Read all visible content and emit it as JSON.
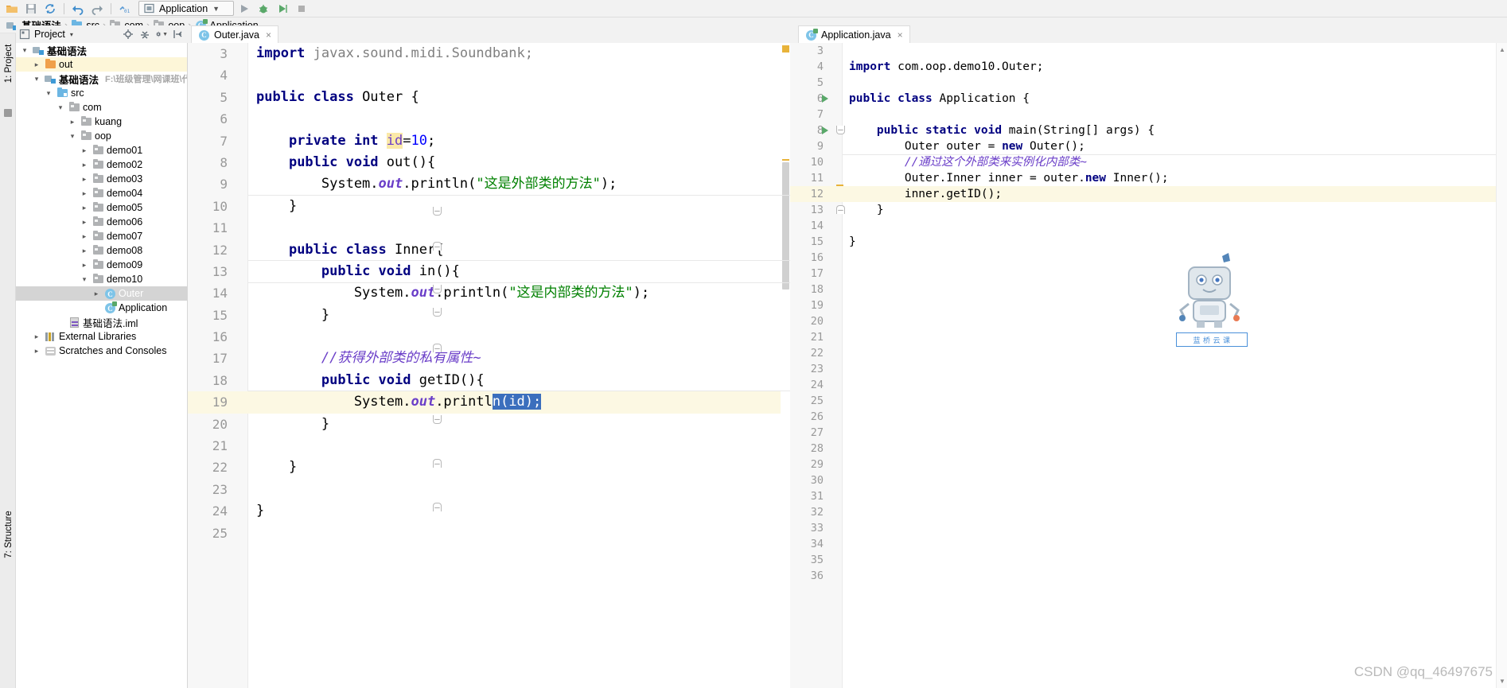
{
  "toolbar": {
    "icons": [
      "open-folder-icon",
      "save-icon",
      "sync-icon",
      "undo-icon",
      "redo-icon",
      "build-icon"
    ],
    "run_config_label": "Application",
    "run_icon": "run-icon",
    "debug_icon": "debug-icon",
    "coverage_icon": "coverage-icon",
    "stop_icon": "stop-icon"
  },
  "breadcrumb": {
    "items": [
      {
        "label": "基础语法",
        "icon": "module-icon"
      },
      {
        "label": "src",
        "icon": "source-folder-icon"
      },
      {
        "label": "com",
        "icon": "package-icon"
      },
      {
        "label": "oop",
        "icon": "package-icon"
      },
      {
        "label": "Application",
        "icon": "java-class-icon"
      }
    ],
    "separator": "›"
  },
  "left_rail": {
    "top_label": "1: Project",
    "bottom_label": "7: Structure"
  },
  "project_panel": {
    "title": "Project",
    "caret": "▾",
    "icons": [
      "locate-icon",
      "collapse-all-icon",
      "settings-icon",
      "hide-icon"
    ],
    "tree": [
      {
        "depth": 0,
        "arrow": "⌄",
        "icon": "module-icon",
        "label": "基础语法",
        "bold": true
      },
      {
        "depth": 1,
        "arrow": "›",
        "icon": "folder-orange",
        "label": "out",
        "highlight": true
      },
      {
        "depth": 1,
        "arrow": "⌄",
        "icon": "module-icon",
        "label": "基础语法",
        "bold": true,
        "path": "F:\\班级管理\\网课班\\代码\\Ja"
      },
      {
        "depth": 2,
        "arrow": "⌄",
        "icon": "folder-src",
        "label": "src"
      },
      {
        "depth": 3,
        "arrow": "⌄",
        "icon": "folder-pkg",
        "label": "com"
      },
      {
        "depth": 4,
        "arrow": "›",
        "icon": "folder-pkg",
        "label": "kuang"
      },
      {
        "depth": 4,
        "arrow": "⌄",
        "icon": "folder-pkg",
        "label": "oop"
      },
      {
        "depth": 5,
        "arrow": "›",
        "icon": "folder-pkg",
        "label": "demo01"
      },
      {
        "depth": 5,
        "arrow": "›",
        "icon": "folder-pkg",
        "label": "demo02"
      },
      {
        "depth": 5,
        "arrow": "›",
        "icon": "folder-pkg",
        "label": "demo03"
      },
      {
        "depth": 5,
        "arrow": "›",
        "icon": "folder-pkg",
        "label": "demo04"
      },
      {
        "depth": 5,
        "arrow": "›",
        "icon": "folder-pkg",
        "label": "demo05"
      },
      {
        "depth": 5,
        "arrow": "›",
        "icon": "folder-pkg",
        "label": "demo06"
      },
      {
        "depth": 5,
        "arrow": "›",
        "icon": "folder-pkg",
        "label": "demo07"
      },
      {
        "depth": 5,
        "arrow": "›",
        "icon": "folder-pkg",
        "label": "demo08"
      },
      {
        "depth": 5,
        "arrow": "›",
        "icon": "folder-pkg",
        "label": "demo09"
      },
      {
        "depth": 5,
        "arrow": "⌄",
        "icon": "folder-pkg",
        "label": "demo10"
      },
      {
        "depth": 6,
        "arrow": "›",
        "icon": "java-class-icon",
        "label": "Outer",
        "selected": true
      },
      {
        "depth": 6,
        "arrow": "",
        "icon": "java-class-run-icon",
        "label": "Application"
      },
      {
        "depth": 3,
        "arrow": "",
        "icon": "iml-file-icon",
        "label": "基础语法.iml"
      },
      {
        "depth": 1,
        "arrow": "›",
        "icon": "libraries-icon",
        "label": "External Libraries"
      },
      {
        "depth": 1,
        "arrow": "›",
        "icon": "scratches-icon",
        "label": "Scratches and Consoles"
      }
    ]
  },
  "editor_left": {
    "tab": {
      "label": "Outer.java",
      "icon": "java-class-icon",
      "close": "×"
    },
    "first_line": 3,
    "lines": [
      {
        "no": 3,
        "tokens": [
          {
            "t": "import ",
            "c": "kw"
          },
          {
            "t": "javax.sound.midi.Soundbank;",
            "c": "cmt"
          }
        ]
      },
      {
        "no": 4,
        "tokens": []
      },
      {
        "no": 5,
        "tokens": [
          {
            "t": "public class ",
            "c": "kw"
          },
          {
            "t": "Outer {",
            "c": "plain"
          }
        ]
      },
      {
        "no": 6,
        "tokens": []
      },
      {
        "no": 7,
        "tokens": [
          {
            "t": "    ",
            "c": "plain"
          },
          {
            "t": "private int ",
            "c": "kw"
          },
          {
            "t": "id",
            "c": "fld idhl"
          },
          {
            "t": "=",
            "c": "plain"
          },
          {
            "t": "10",
            "c": "num"
          },
          {
            "t": ";",
            "c": "plain"
          }
        ]
      },
      {
        "no": 8,
        "tokens": [
          {
            "t": "    ",
            "c": "plain"
          },
          {
            "t": "public void ",
            "c": "kw"
          },
          {
            "t": "out(){",
            "c": "plain"
          }
        ]
      },
      {
        "no": 9,
        "tokens": [
          {
            "t": "        System.",
            "c": "plain"
          },
          {
            "t": "out",
            "c": "stat"
          },
          {
            "t": ".println(",
            "c": "plain"
          },
          {
            "t": "\"这是外部类的方法\"",
            "c": "str"
          },
          {
            "t": ");",
            "c": "plain"
          }
        ]
      },
      {
        "no": 10,
        "tokens": [
          {
            "t": "    }",
            "c": "plain"
          }
        ]
      },
      {
        "no": 11,
        "tokens": []
      },
      {
        "no": 12,
        "tokens": [
          {
            "t": "    ",
            "c": "plain"
          },
          {
            "t": "public class ",
            "c": "kw"
          },
          {
            "t": "Inner{",
            "c": "plain"
          }
        ]
      },
      {
        "no": 13,
        "tokens": [
          {
            "t": "        ",
            "c": "plain"
          },
          {
            "t": "public void ",
            "c": "kw"
          },
          {
            "t": "in(){",
            "c": "plain"
          }
        ]
      },
      {
        "no": 14,
        "tokens": [
          {
            "t": "            System.",
            "c": "plain"
          },
          {
            "t": "out",
            "c": "stat"
          },
          {
            "t": ".println(",
            "c": "plain"
          },
          {
            "t": "\"这是内部类的方法\"",
            "c": "str"
          },
          {
            "t": ");",
            "c": "plain"
          }
        ]
      },
      {
        "no": 15,
        "tokens": [
          {
            "t": "        }",
            "c": "plain"
          }
        ]
      },
      {
        "no": 16,
        "tokens": []
      },
      {
        "no": 17,
        "tokens": [
          {
            "t": "        ",
            "c": "plain"
          },
          {
            "t": "//获得外部类的私有属性~",
            "c": "cmt-it"
          }
        ]
      },
      {
        "no": 18,
        "tokens": [
          {
            "t": "        ",
            "c": "plain"
          },
          {
            "t": "public void ",
            "c": "kw"
          },
          {
            "t": "getID(){",
            "c": "plain"
          }
        ]
      },
      {
        "no": 19,
        "tokens": [
          {
            "t": "            System.",
            "c": "plain"
          },
          {
            "t": "out",
            "c": "stat"
          },
          {
            "t": ".printl",
            "c": "plain"
          },
          {
            "t": "n(id);",
            "c": "sel"
          }
        ],
        "current": true
      },
      {
        "no": 20,
        "tokens": [
          {
            "t": "        }",
            "c": "plain"
          }
        ]
      },
      {
        "no": 21,
        "tokens": []
      },
      {
        "no": 22,
        "tokens": [
          {
            "t": "    }",
            "c": "plain"
          }
        ]
      },
      {
        "no": 23,
        "tokens": []
      },
      {
        "no": 24,
        "tokens": [
          {
            "t": "}",
            "c": "plain"
          }
        ]
      },
      {
        "no": 25,
        "tokens": []
      }
    ]
  },
  "editor_right": {
    "tab": {
      "label": "Application.java",
      "icon": "java-class-run-icon",
      "close": "×"
    },
    "lines": [
      {
        "no": 3,
        "tokens": []
      },
      {
        "no": 4,
        "tokens": [
          {
            "t": "import ",
            "c": "kw"
          },
          {
            "t": "com.oop.demo10.Outer;",
            "c": "plain"
          }
        ]
      },
      {
        "no": 5,
        "tokens": []
      },
      {
        "no": 6,
        "tokens": [
          {
            "t": "public class ",
            "c": "kw"
          },
          {
            "t": "Application {",
            "c": "plain"
          }
        ],
        "run": true
      },
      {
        "no": 7,
        "tokens": []
      },
      {
        "no": 8,
        "tokens": [
          {
            "t": "    ",
            "c": "plain"
          },
          {
            "t": "public static void ",
            "c": "kw"
          },
          {
            "t": "main(String[] args) {",
            "c": "plain"
          }
        ],
        "run": true
      },
      {
        "no": 9,
        "tokens": [
          {
            "t": "        Outer outer = ",
            "c": "plain"
          },
          {
            "t": "new ",
            "c": "kw"
          },
          {
            "t": "Outer();",
            "c": "plain"
          }
        ]
      },
      {
        "no": 10,
        "tokens": [
          {
            "t": "        ",
            "c": "plain"
          },
          {
            "t": "//通过这个外部类来实例化内部类~",
            "c": "cmt-it"
          }
        ]
      },
      {
        "no": 11,
        "tokens": [
          {
            "t": "        Outer.Inner inner = outer.",
            "c": "plain"
          },
          {
            "t": "new ",
            "c": "kw"
          },
          {
            "t": "Inner();",
            "c": "plain"
          }
        ]
      },
      {
        "no": 12,
        "tokens": [
          {
            "t": "        inner.getID();",
            "c": "plain"
          }
        ],
        "current": true
      },
      {
        "no": 13,
        "tokens": [
          {
            "t": "    }",
            "c": "plain"
          }
        ]
      },
      {
        "no": 14,
        "tokens": []
      },
      {
        "no": 15,
        "tokens": [
          {
            "t": "}",
            "c": "plain"
          }
        ]
      },
      {
        "no": 16,
        "tokens": []
      },
      {
        "no": 17,
        "tokens": []
      },
      {
        "no": 18,
        "tokens": []
      },
      {
        "no": 19,
        "tokens": []
      },
      {
        "no": 20,
        "tokens": []
      },
      {
        "no": 21,
        "tokens": []
      },
      {
        "no": 22,
        "tokens": []
      },
      {
        "no": 23,
        "tokens": []
      },
      {
        "no": 24,
        "tokens": []
      },
      {
        "no": 25,
        "tokens": []
      },
      {
        "no": 26,
        "tokens": []
      },
      {
        "no": 27,
        "tokens": []
      },
      {
        "no": 28,
        "tokens": []
      },
      {
        "no": 29,
        "tokens": []
      },
      {
        "no": 30,
        "tokens": []
      },
      {
        "no": 31,
        "tokens": []
      },
      {
        "no": 32,
        "tokens": []
      },
      {
        "no": 33,
        "tokens": []
      },
      {
        "no": 34,
        "tokens": []
      },
      {
        "no": 35,
        "tokens": []
      },
      {
        "no": 36,
        "tokens": []
      }
    ]
  },
  "mascot": {
    "caption": "蓝 桥 云 课"
  },
  "watermark": "CSDN @qq_46497675",
  "colors": {
    "keyword": "#000080",
    "string": "#008000",
    "number": "#0000ff",
    "comment": "#6a3ec8",
    "selection": "#3b6fbd",
    "current_line": "#fcf8e3",
    "accent": "#4a90d9"
  }
}
